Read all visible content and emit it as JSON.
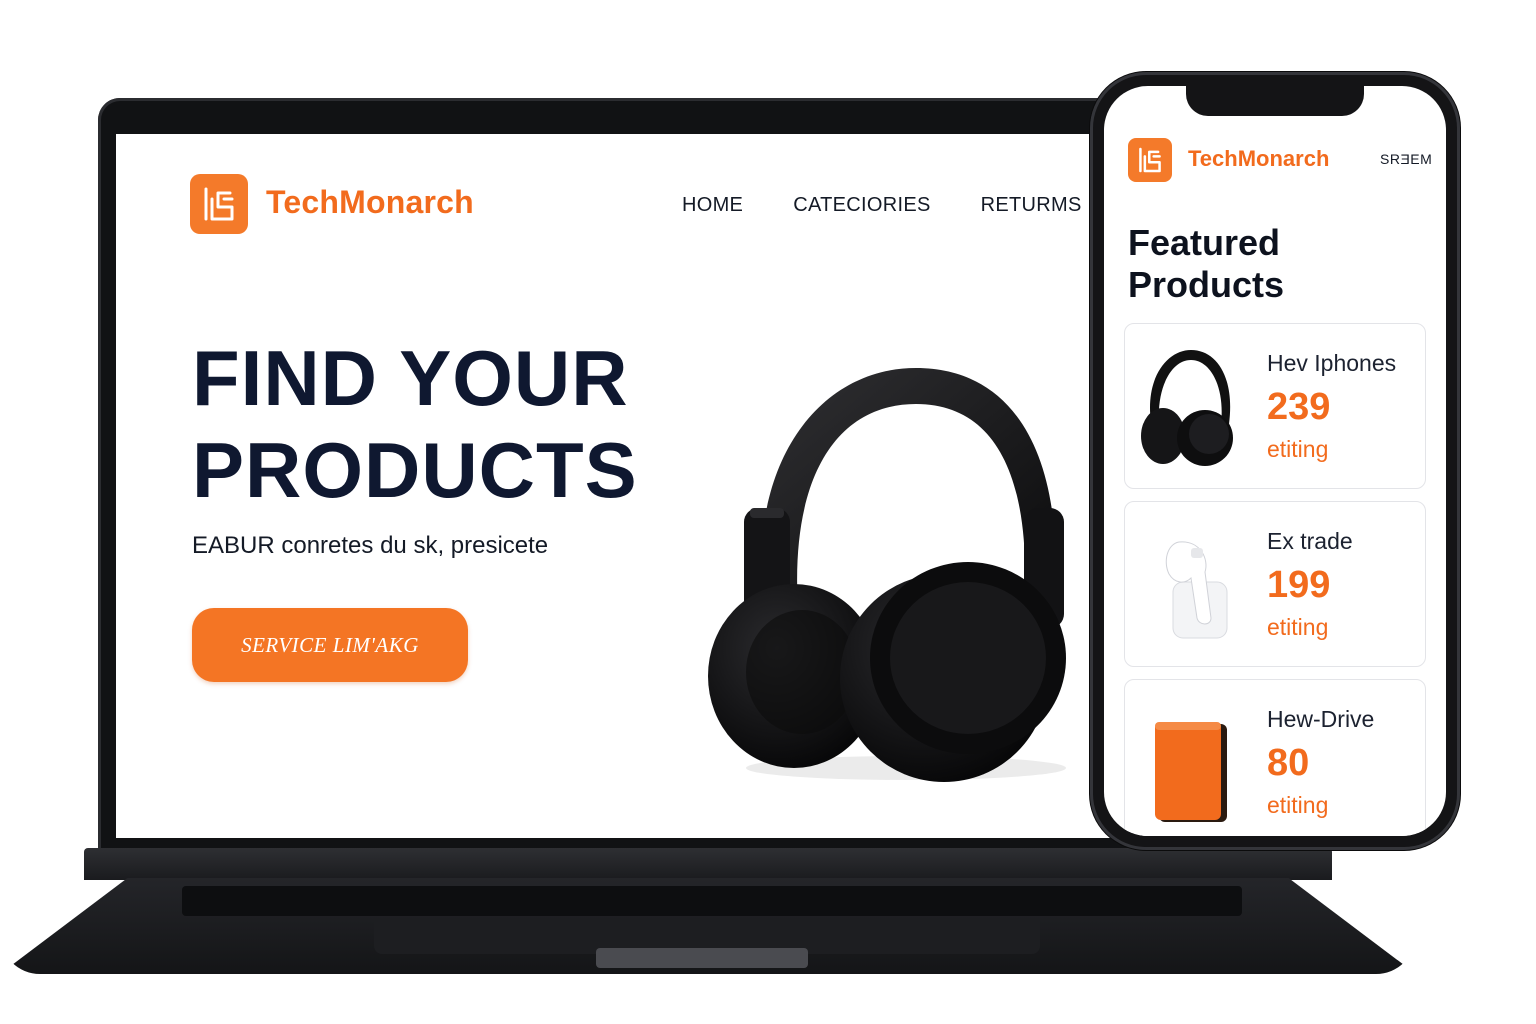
{
  "colors": {
    "accent": "#f26b1d",
    "button": "#f47524",
    "heading": "#0f1830",
    "device_frame": "#141416"
  },
  "desktop": {
    "brand": "TechMonarch",
    "logo_icon": "brand-logo-icon",
    "nav": [
      "HOME",
      "CATECIORIES",
      "RETURMS"
    ],
    "hero": {
      "title_line1": "FIND YOUR",
      "title_line2": "PRODUCTS",
      "subtitle": "EABUR  conretes du  sk, presicete",
      "cta_label": "SERVICE LIM'AKG"
    },
    "hero_image": "headphones-image"
  },
  "mobile": {
    "brand": "TechMonarch",
    "menu_label": "SRƎEM",
    "heading_line1": "Featured",
    "heading_line2": "Products",
    "products": [
      {
        "name": "Hev Iphones",
        "price": "239",
        "status": "etiting",
        "image": "headphones-image"
      },
      {
        "name": "Ex trade",
        "price": "199",
        "status": "etiting",
        "image": "earbud-image"
      },
      {
        "name": "Hew-Drive",
        "price": "80",
        "status": "etiting",
        "image": "drive-image"
      }
    ]
  }
}
